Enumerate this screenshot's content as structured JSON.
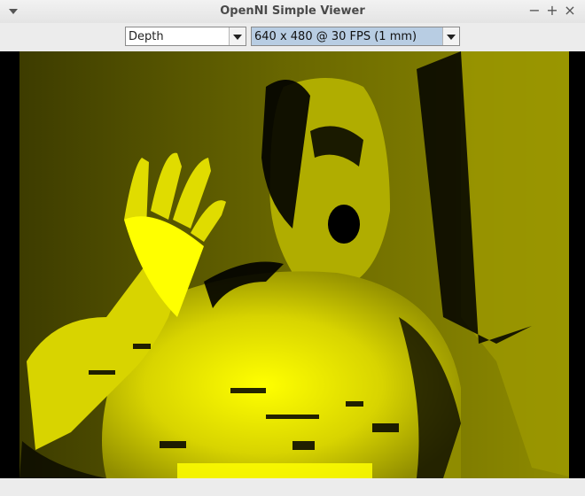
{
  "window": {
    "title": "OpenNI Simple Viewer",
    "minimize_symbol": "−",
    "maximize_symbol": "+",
    "close_symbol": "×"
  },
  "toolbar": {
    "stream_select": {
      "value": "Depth"
    },
    "mode_select": {
      "value": "640 x 480 @ 30 FPS (1 mm)"
    }
  },
  "viewer": {
    "stream": "depth",
    "colors": {
      "near": "#ffff00",
      "mid": "#b5b000",
      "far": "#5b5a00",
      "shadow": "#000000"
    }
  }
}
